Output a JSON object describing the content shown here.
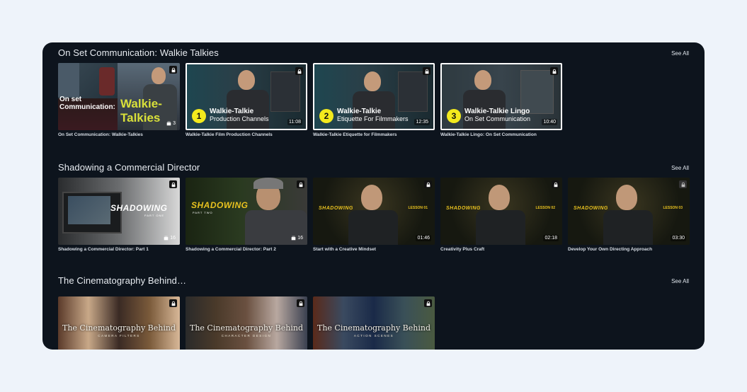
{
  "sections": [
    {
      "title": "On Set Communication: Walkie Talkies",
      "see_all": "See All",
      "cards": [
        {
          "caption": "On Set Communication: Walkie-Talkies",
          "count": "3",
          "overlay_line1": "On set",
          "overlay_line2": "Communication:",
          "overlay_big1": "Walkie-",
          "overlay_big2": "Talkies"
        },
        {
          "caption": "Walkie-Talkie Film Production Channels",
          "duration": "11:08",
          "number": "1",
          "title_line1": "Walkie-Talkie",
          "title_line2": "Production Channels"
        },
        {
          "caption": "Walkie-Talkie Etiquette for Filmmakers",
          "duration": "12:35",
          "number": "2",
          "title_line1": "Walkie-Talkie",
          "title_line2": "Etiquette For Filmmakers"
        },
        {
          "caption": "Walkie-Talkie Lingo: On Set Communication",
          "duration": "10:40",
          "number": "3",
          "title_line1": "Walkie-Talkie Lingo",
          "title_line2": "On Set Communication"
        }
      ]
    },
    {
      "title": "Shadowing a Commercial Director",
      "see_all": "See All",
      "cards": [
        {
          "caption": "Shadowing a Commercial Director: Part 1",
          "count": "16",
          "overlay": "SHADOWING",
          "part": "PART ONE"
        },
        {
          "caption": "Shadowing a Commercial Director: Part 2",
          "count": "16",
          "overlay": "SHADOWING",
          "part": "PART TWO"
        },
        {
          "caption": "Start with a Creative Mindset",
          "duration": "01:46",
          "overlay": "SHADOWING",
          "lesson": "LESSON 01"
        },
        {
          "caption": "Creativity Plus Craft",
          "duration": "02:18",
          "overlay": "SHADOWING",
          "lesson": "LESSON 02"
        },
        {
          "caption": "Develop Your Own Directing Approach",
          "duration": "03:30",
          "overlay": "SHADOWING",
          "lesson": "LESSON 03"
        }
      ]
    },
    {
      "title": "The Cinematography Behind…",
      "see_all": "See All",
      "cards": [
        {
          "overlay": "The Cinematography Behind",
          "sub": "CAMERA FILTERS"
        },
        {
          "overlay": "The Cinematography Behind",
          "sub": "CHARACTER DESIGN"
        },
        {
          "overlay": "The Cinematography Behind",
          "sub": "ACTION SCENES"
        }
      ]
    }
  ],
  "icons": {
    "lock": "lock-icon",
    "stack": "stack-icon"
  },
  "colors": {
    "panel": "#0d141d",
    "background": "#eef3fa",
    "badge": "#f3ea1d",
    "shadowing_yellow": "#e9c21f"
  }
}
